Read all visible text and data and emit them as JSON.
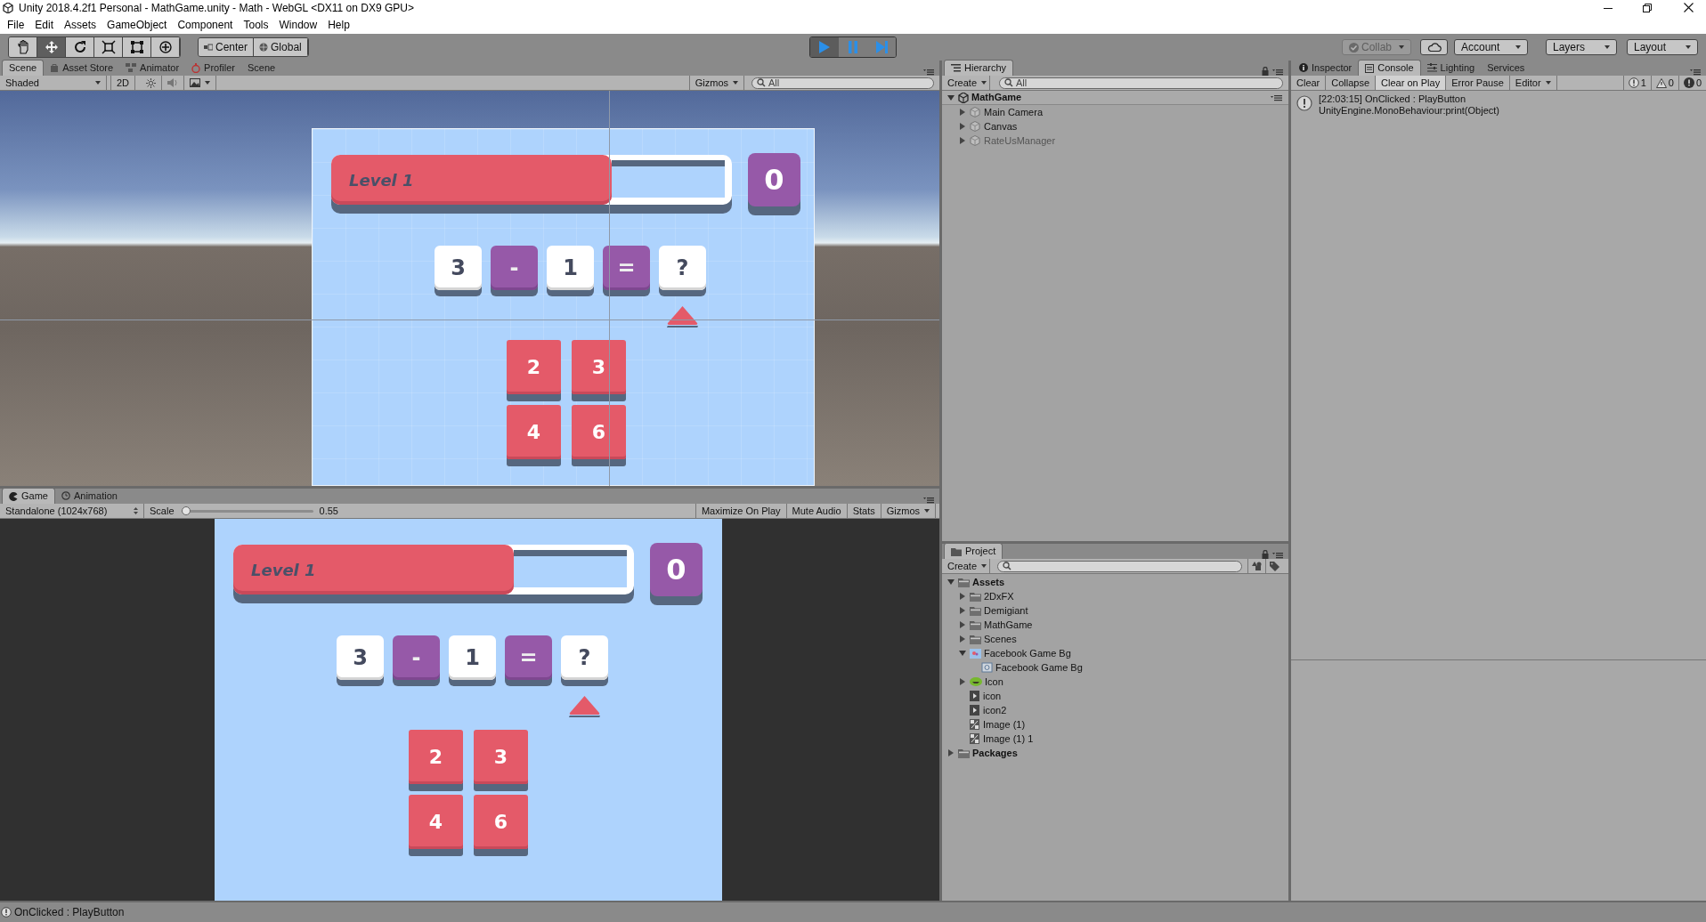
{
  "window": {
    "title": "Unity 2018.4.2f1 Personal - MathGame.unity - Math - WebGL <DX11 on DX9 GPU>"
  },
  "menu": [
    "File",
    "Edit",
    "Assets",
    "GameObject",
    "Component",
    "Tools",
    "Window",
    "Help"
  ],
  "toolbar": {
    "tools": [
      {
        "kind": "hand",
        "selected": false
      },
      {
        "kind": "move",
        "selected": true
      },
      {
        "kind": "rotate",
        "selected": false
      },
      {
        "kind": "scale",
        "selected": false
      },
      {
        "kind": "rect",
        "selected": false
      },
      {
        "kind": "transform",
        "selected": false
      }
    ],
    "pivot": [
      {
        "kind": "center",
        "label": "Center"
      },
      {
        "kind": "global",
        "label": "Global"
      }
    ],
    "play": {
      "playing": true,
      "paused": false
    },
    "collab": {
      "label": "Collab",
      "disabled": true
    },
    "account": "Account",
    "layers": "Layers",
    "layout": "Layout"
  },
  "scene_panel": {
    "tabs": [
      {
        "label": "Scene",
        "kind": "plain",
        "selected": true
      },
      {
        "label": "Asset Store",
        "kind": "store",
        "selected": false
      },
      {
        "label": "Animator",
        "kind": "animator",
        "selected": false
      },
      {
        "label": "Profiler",
        "kind": "profiler",
        "selected": false
      },
      {
        "label": "Scene",
        "kind": "plain",
        "selected": false
      }
    ],
    "shading": "Shaded",
    "mode": "2D",
    "gizmos": "Gizmos",
    "search_placeholder": "All",
    "game": {
      "level_label": "Level 1",
      "level": 0.7,
      "score": "0",
      "equation": [
        {
          "text": "3",
          "kind": "number",
          "selected": false
        },
        {
          "text": "-",
          "kind": "operator",
          "selected": false
        },
        {
          "text": "1",
          "kind": "number",
          "selected": false
        },
        {
          "text": "=",
          "kind": "operator",
          "selected": false
        },
        {
          "text": "?",
          "kind": "number",
          "selected": true
        }
      ],
      "answers": [
        "2",
        "3",
        "4",
        "6"
      ]
    }
  },
  "game_panel": {
    "tabs": [
      {
        "label": "Game",
        "kind": "game",
        "selected": true
      },
      {
        "label": "Animation",
        "kind": "animation",
        "selected": false
      }
    ],
    "display": "Standalone (1024x768)",
    "scale_label": "Scale",
    "scale": {
      "level": 0.0
    },
    "scale_value": "0.55",
    "buttons": [
      "Maximize On Play",
      "Mute Audio",
      "Stats"
    ],
    "gizmos": "Gizmos",
    "game": {
      "level_label": "Level 1",
      "level": 0.7,
      "score": "0",
      "equation": [
        {
          "text": "3",
          "kind": "number",
          "selected": false
        },
        {
          "text": "-",
          "kind": "operator",
          "selected": false
        },
        {
          "text": "1",
          "kind": "number",
          "selected": false
        },
        {
          "text": "=",
          "kind": "operator",
          "selected": false
        },
        {
          "text": "?",
          "kind": "number",
          "selected": true
        }
      ],
      "answers": [
        "2",
        "3",
        "4",
        "6"
      ]
    }
  },
  "hierarchy": {
    "tab": "Hierarchy",
    "create": "Create",
    "search_placeholder": "All",
    "items": [
      {
        "label": "MathGame",
        "kind": "scene",
        "expanded": true,
        "disabled": false,
        "children": [
          {
            "label": "Main Camera",
            "kind": "object",
            "expanded": false,
            "disabled": false
          },
          {
            "label": "Canvas",
            "kind": "object",
            "expanded": false,
            "disabled": false
          },
          {
            "label": "RateUsManager",
            "kind": "object",
            "expanded": false,
            "disabled": true
          }
        ]
      }
    ]
  },
  "console": {
    "tabs": [
      {
        "label": "Inspector",
        "kind": "info",
        "selected": false
      },
      {
        "label": "Console",
        "kind": "console",
        "selected": true
      },
      {
        "label": "Lighting",
        "kind": "lighting",
        "selected": false
      },
      {
        "label": "Services",
        "kind": "plain",
        "selected": false
      }
    ],
    "buttons": [
      {
        "label": "Clear",
        "kind": "button"
      },
      {
        "label": "Collapse",
        "kind": "toggle",
        "on": false
      },
      {
        "label": "Clear on Play",
        "kind": "toggle",
        "on": true
      },
      {
        "label": "Error Pause",
        "kind": "toggle",
        "on": false
      },
      {
        "label": "Editor",
        "kind": "dropdown"
      }
    ],
    "counts": [
      {
        "kind": "info",
        "count": "1"
      },
      {
        "kind": "warning",
        "count": "0"
      },
      {
        "kind": "error",
        "count": "0"
      }
    ],
    "messages": [
      {
        "kind": "info",
        "lines": [
          "[22:03:15] OnClicked : PlayButton",
          "UnityEngine.MonoBehaviour:print(Object)"
        ]
      }
    ]
  },
  "project": {
    "tab": "Project",
    "create": "Create",
    "items": [
      {
        "label": "Assets",
        "kind": "folder",
        "expanded": true,
        "children": [
          {
            "label": "2DxFX",
            "kind": "folder",
            "expanded": false
          },
          {
            "label": "Demigiant",
            "kind": "folder",
            "expanded": false
          },
          {
            "label": "MathGame",
            "kind": "folder",
            "expanded": false
          },
          {
            "label": "Scenes",
            "kind": "folder",
            "expanded": false
          },
          {
            "label": "Facebook Game Bg",
            "kind": "texture",
            "expanded": true,
            "children": [
              {
                "label": "Facebook Game Bg",
                "kind": "sprite"
              }
            ]
          },
          {
            "label": "Icon",
            "kind": "model",
            "expanded": false
          },
          {
            "label": "icon",
            "kind": "anim"
          },
          {
            "label": "icon2",
            "kind": "anim"
          },
          {
            "label": "Image (1)",
            "kind": "sheet"
          },
          {
            "label": "Image (1) 1",
            "kind": "sheet"
          }
        ]
      },
      {
        "label": "Packages",
        "kind": "folder",
        "expanded": false
      }
    ]
  },
  "status_bar": {
    "kind": "info",
    "text": "OnClicked : PlayButton"
  }
}
